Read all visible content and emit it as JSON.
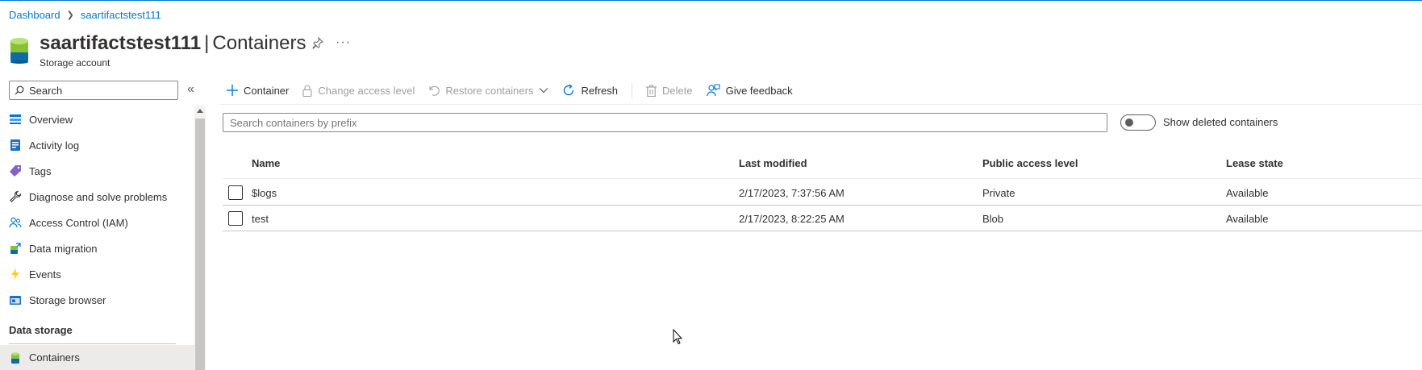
{
  "breadcrumb": {
    "items": [
      "Dashboard",
      "saartifactstest111"
    ]
  },
  "header": {
    "resource_name": "saartifactstest111",
    "divider": "|",
    "page_name": "Containers",
    "subtitle": "Storage account",
    "pin_icon": "pin-icon",
    "more_icon": "ellipsis-icon"
  },
  "sidebar": {
    "search_placeholder": "Search",
    "items": [
      {
        "label": "Overview",
        "icon": "overview-icon"
      },
      {
        "label": "Activity log",
        "icon": "activity-log-icon"
      },
      {
        "label": "Tags",
        "icon": "tag-icon"
      },
      {
        "label": "Diagnose and solve problems",
        "icon": "wrench-icon"
      },
      {
        "label": "Access Control (IAM)",
        "icon": "people-icon"
      },
      {
        "label": "Data migration",
        "icon": "data-migration-icon"
      },
      {
        "label": "Events",
        "icon": "lightning-icon"
      },
      {
        "label": "Storage browser",
        "icon": "storage-browser-icon"
      }
    ],
    "section_title": "Data storage",
    "active_item": {
      "label": "Containers",
      "icon": "containers-icon"
    }
  },
  "toolbar": {
    "container": "Container",
    "change_access": "Change access level",
    "restore": "Restore containers",
    "refresh": "Refresh",
    "delete": "Delete",
    "feedback": "Give feedback"
  },
  "filter": {
    "placeholder": "Search containers by prefix"
  },
  "toggle": {
    "label": "Show deleted containers",
    "checked": false
  },
  "table": {
    "columns": [
      "Name",
      "Last modified",
      "Public access level",
      "Lease state"
    ],
    "rows": [
      {
        "name": "$logs",
        "modified": "2/17/2023, 7:37:56 AM",
        "access": "Private",
        "lease": "Available"
      },
      {
        "name": "test",
        "modified": "2/17/2023, 8:22:25 AM",
        "access": "Blob",
        "lease": "Available"
      }
    ]
  },
  "colors": {
    "accent": "#0078d4",
    "selected": "#edebe9"
  }
}
